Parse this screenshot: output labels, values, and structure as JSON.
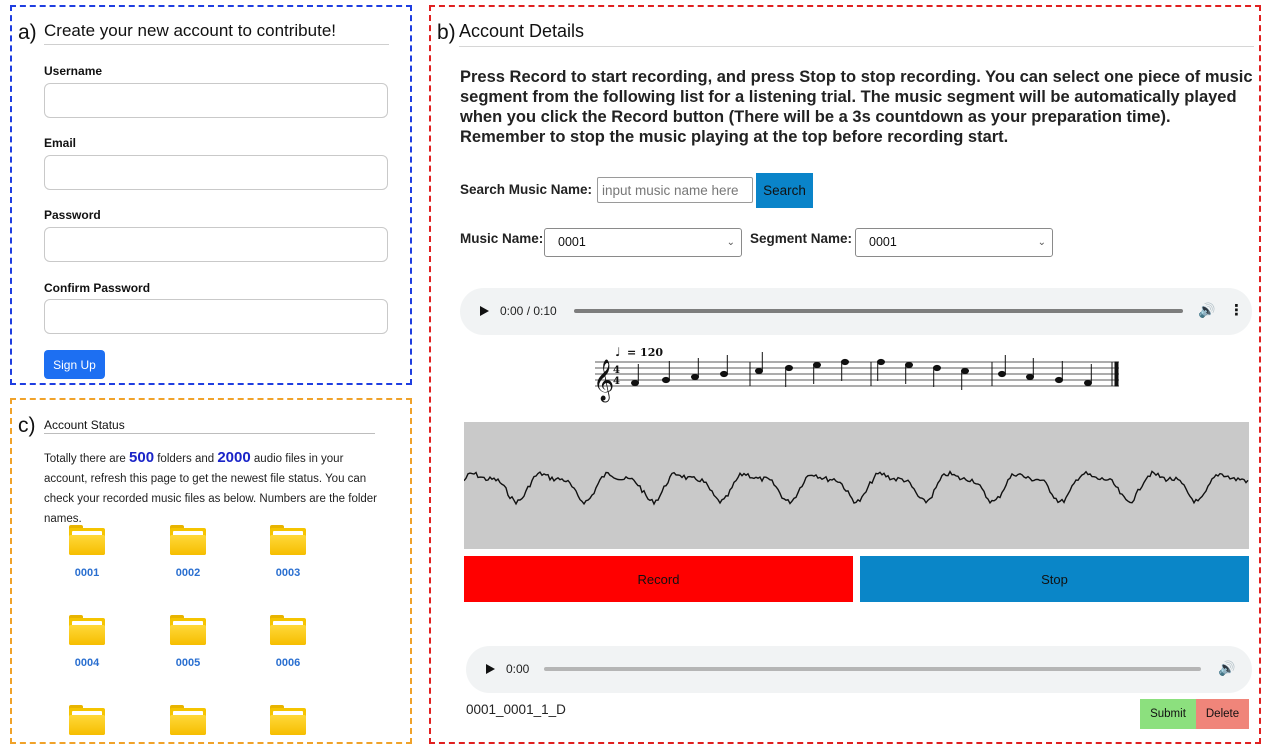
{
  "panel_a": {
    "letter": "a)",
    "title": "Create your new account to contribute!",
    "fields": [
      {
        "label": "Username"
      },
      {
        "label": "Email"
      },
      {
        "label": "Password"
      },
      {
        "label": "Confirm Password"
      }
    ],
    "signup_label": "Sign Up",
    "border_color": "#1f3ee0",
    "button_color": "#1d6ff2"
  },
  "panel_c": {
    "letter": "c)",
    "title": "Account Status",
    "text_before_folders": "Totally there are ",
    "folder_count": "500",
    "text_mid": " folders and ",
    "file_count": "2000",
    "text_after": " audio files in your account, refresh this page to get the newest file status. You can check your recorded music files as below. Numbers are the folder names.",
    "folders": [
      "0001",
      "0002",
      "0003",
      "0004",
      "0005",
      "0006"
    ],
    "border_color": "#f0a22a"
  },
  "panel_b": {
    "letter": "b)",
    "title": "Account Details",
    "instructions": {
      "p1": "Press ",
      "record_word": "Record",
      "p2": " to start recording, and press ",
      "stop_word": "Stop",
      "p3": " to stop recording. You can select one piece of music segment from the following list for a listening trial. The music segment will be automatically played when you click the ",
      "record_word2": "Record",
      "p4": " button (There will be a 3s countdown as your preparation time). Remember to stop the music playing at the top before recording start."
    },
    "search_label": "Search Music Name:",
    "search_placeholder": "input music name here",
    "search_button": "Search",
    "music_name_label": "Music Name:",
    "music_name_value": "0001",
    "segment_name_label": "Segment Name:",
    "segment_name_value": "0001",
    "player1_time": "0:00 / 0:10",
    "tempo_text": "= 120",
    "record_label": "Record",
    "stop_label": "Stop",
    "player2_time": "0:00",
    "recorded_file": "0001_0001_1_D",
    "submit_label": "Submit",
    "delete_label": "Delete",
    "border_color": "#e02020",
    "record_color": "#ff0000",
    "stop_color": "#0a86c8"
  }
}
